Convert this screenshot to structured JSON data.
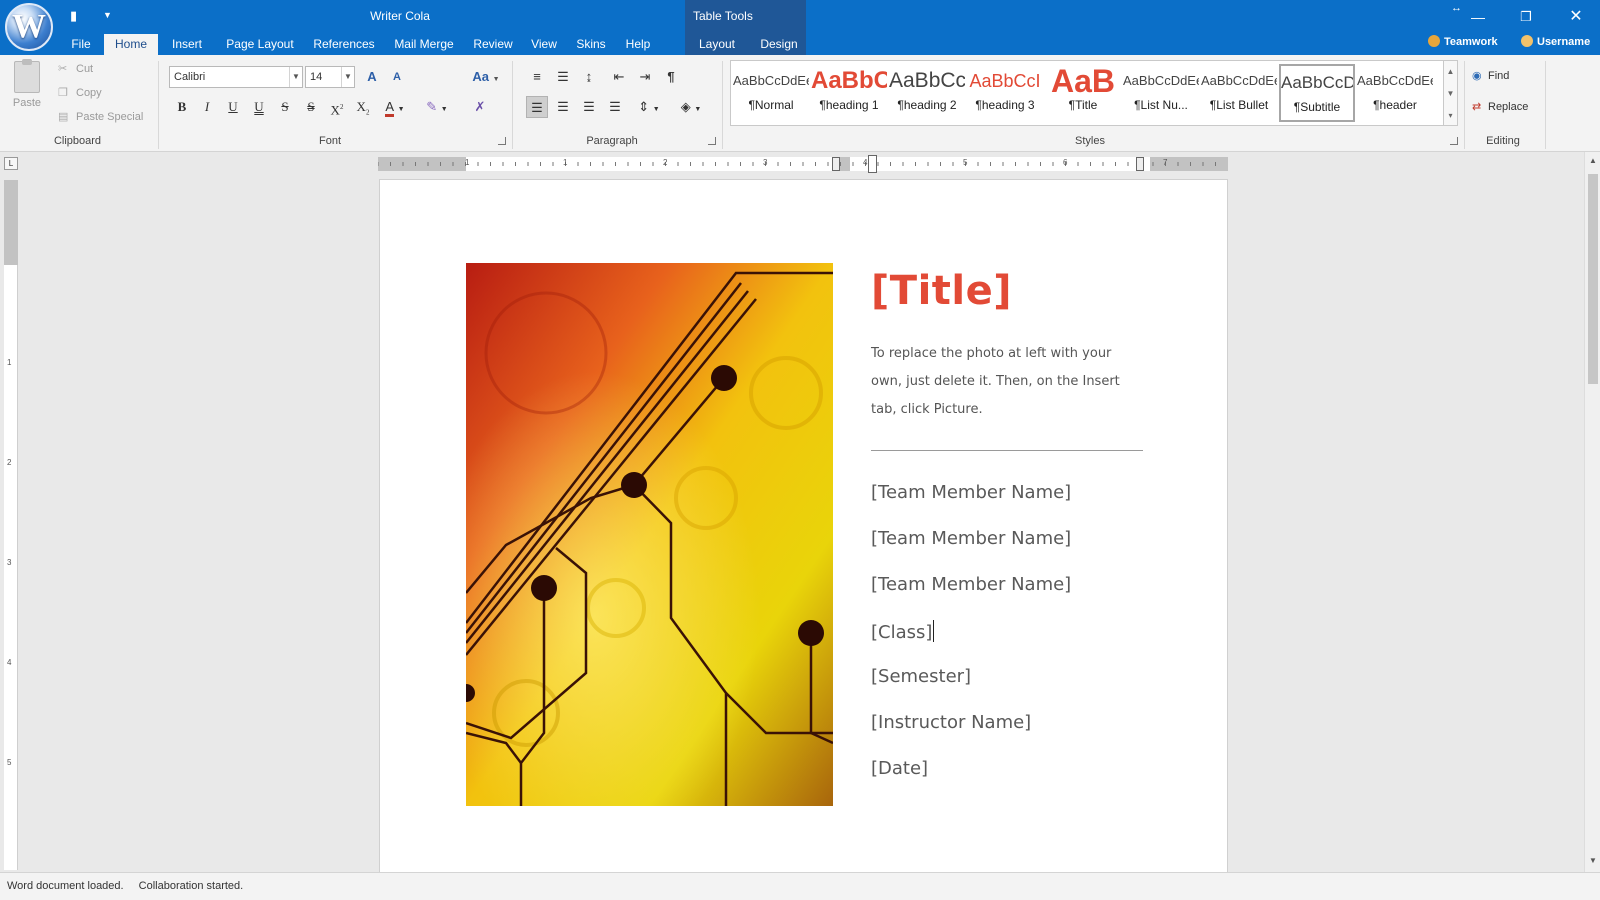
{
  "app": {
    "title": "Writer Cola",
    "logo_letter": "W",
    "contextual_group": "Table Tools"
  },
  "tabs": [
    {
      "label": "File"
    },
    {
      "label": "Home"
    },
    {
      "label": "Insert"
    },
    {
      "label": "Page Layout"
    },
    {
      "label": "References"
    },
    {
      "label": "Mail Merge"
    },
    {
      "label": "Review"
    },
    {
      "label": "View"
    },
    {
      "label": "Skins"
    },
    {
      "label": "Help"
    },
    {
      "label": "Layout"
    },
    {
      "label": "Design"
    }
  ],
  "active_tab": "Home",
  "user": {
    "teamwork": "Teamwork",
    "username": "Username"
  },
  "ribbon": {
    "clipboard": {
      "group_label": "Clipboard",
      "paste": "Paste",
      "cut": "Cut",
      "copy": "Copy",
      "paste_special": "Paste Special"
    },
    "font": {
      "group_label": "Font",
      "font_name": "Calibri",
      "font_size": "14",
      "change_case": "Aa"
    },
    "paragraph": {
      "group_label": "Paragraph"
    },
    "styles": {
      "group_label": "Styles",
      "items": [
        {
          "preview": "AaBbCcDdEe",
          "name": "¶Normal"
        },
        {
          "preview": "AaBbC",
          "name": "¶heading 1"
        },
        {
          "preview": "AaBbCc",
          "name": "¶heading 2"
        },
        {
          "preview": "AaBbCcI",
          "name": "¶heading 3"
        },
        {
          "preview": "AaB",
          "name": "¶Title"
        },
        {
          "preview": "AaBbCcDdEe",
          "name": "¶List Nu..."
        },
        {
          "preview": "AaBbCcDdEe",
          "name": "¶List Bullet"
        },
        {
          "preview": "AaBbCcD",
          "name": "¶Subtitle"
        },
        {
          "preview": "AaBbCcDdEe",
          "name": "¶header"
        }
      ],
      "selected": "¶Subtitle"
    },
    "editing": {
      "group_label": "Editing",
      "find": "Find",
      "replace": "Replace"
    }
  },
  "colors": {
    "accent_blue": "#0b6fc8",
    "title_red": "#e24a36",
    "ribbon_bg": "#f3f3f3"
  },
  "document": {
    "title": "[Title]",
    "description": "To replace the photo at left with your own, just delete it. Then, on the Insert tab, click Picture.",
    "lines": [
      "[Team Member Name]",
      "[Team Member Name]",
      "[Team Member Name]",
      "[Class]",
      "[Semester]",
      "[Instructor Name]",
      "[Date]"
    ]
  },
  "ruler": {
    "h_numbers": [
      "1",
      "1",
      "2",
      "3",
      "4",
      "5",
      "6",
      "7"
    ],
    "v_numbers": [
      "1",
      "2",
      "3",
      "4",
      "5"
    ]
  },
  "status": {
    "message1": "Word document loaded.",
    "message2": "Collaboration started."
  }
}
